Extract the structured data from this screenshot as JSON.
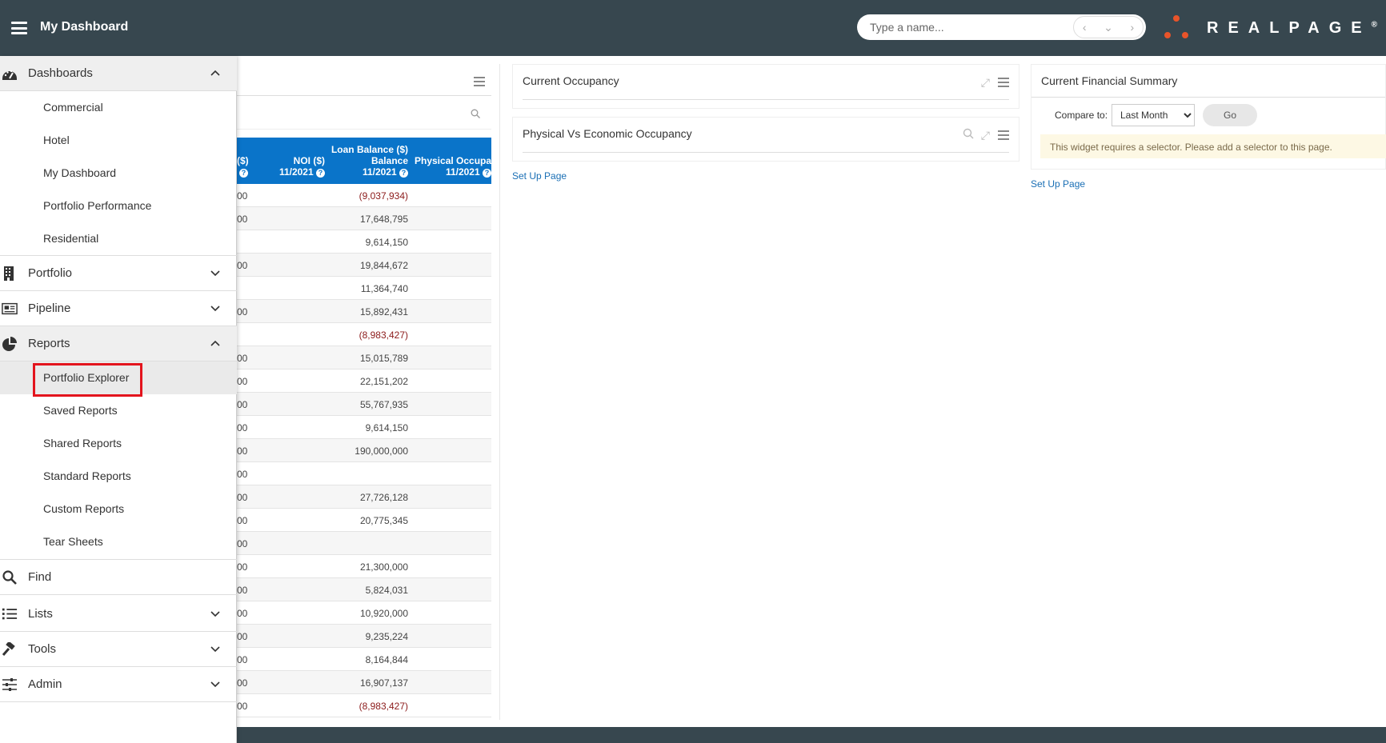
{
  "header": {
    "title": "My Dashboard",
    "search_placeholder": "Type a name...",
    "nav_prev": "‹",
    "nav_down": "⌄",
    "nav_next": "›",
    "logo_text": "REALPAGE",
    "logo_trademark": "®"
  },
  "sidebar": {
    "sections": [
      {
        "label": "Dashboards",
        "icon": "dashboard-gauge-icon",
        "expanded": true,
        "items": [
          "Commercial",
          "Hotel",
          "My Dashboard",
          "Portfolio Performance",
          "Residential"
        ]
      },
      {
        "label": "Portfolio",
        "icon": "building-icon",
        "expanded": false
      },
      {
        "label": "Pipeline",
        "icon": "newspaper-icon",
        "expanded": false
      },
      {
        "label": "Reports",
        "icon": "pie-chart-icon",
        "expanded": true,
        "items": [
          "Portfolio Explorer",
          "Saved Reports",
          "Shared Reports",
          "Standard Reports",
          "Custom Reports",
          "Tear Sheets"
        ],
        "active_item": "Portfolio Explorer"
      },
      {
        "label": "Find",
        "icon": "search-icon"
      },
      {
        "label": "Lists",
        "icon": "list-icon",
        "expanded": false
      },
      {
        "label": "Tools",
        "icon": "hammer-icon",
        "expanded": false
      },
      {
        "label": "Admin",
        "icon": "sliders-icon",
        "expanded": false
      }
    ]
  },
  "table_widget": {
    "columns": [
      {
        "line1": "",
        "line2": "($)",
        "line3": "?"
      },
      {
        "line1": "",
        "line2": "NOI ($)",
        "line3": "11/2021"
      },
      {
        "line1": "Loan Balance ($)",
        "line2": "Balance",
        "line3": "11/2021"
      },
      {
        "line1": "",
        "line2": "Physical Occupan",
        "line3": "11/2021"
      }
    ],
    "rows": [
      {
        "c1": "00",
        "loan": "(9,037,934)",
        "neg": true
      },
      {
        "c1": "00",
        "loan": "17,648,795"
      },
      {
        "c1": "",
        "loan": "9,614,150"
      },
      {
        "c1": "00",
        "loan": "19,844,672"
      },
      {
        "c1": "",
        "loan": "11,364,740"
      },
      {
        "c1": "00",
        "loan": "15,892,431"
      },
      {
        "c1": "",
        "loan": "(8,983,427)",
        "neg": true
      },
      {
        "c1": "00",
        "loan": "15,015,789"
      },
      {
        "c1": "00",
        "loan": "22,151,202"
      },
      {
        "c1": "00",
        "loan": "55,767,935"
      },
      {
        "c1": "00",
        "loan": "9,614,150"
      },
      {
        "c1": "00",
        "loan": "190,000,000"
      },
      {
        "c1": "00",
        "loan": ""
      },
      {
        "c1": "00",
        "loan": "27,726,128"
      },
      {
        "c1": "00",
        "loan": "20,775,345"
      },
      {
        "c1": "00",
        "loan": ""
      },
      {
        "c1": "00",
        "loan": "21,300,000"
      },
      {
        "c1": "00",
        "loan": "5,824,031"
      },
      {
        "c1": "00",
        "loan": "10,920,000"
      },
      {
        "c1": "00",
        "loan": "9,235,224"
      },
      {
        "c1": "00",
        "loan": "8,164,844"
      },
      {
        "c1": "00",
        "loan": "16,907,137"
      },
      {
        "c1": "00",
        "loan": "(8,983,427)",
        "neg": true
      }
    ]
  },
  "widgets": {
    "current_occupancy": {
      "title": "Current Occupancy"
    },
    "phys_vs_econ": {
      "title": "Physical Vs Economic Occupancy"
    },
    "setup_link_1": "Set Up Page",
    "financial_summary": {
      "title": "Current Financial Summary",
      "compare_label": "Compare to:",
      "compare_value": "Last Month",
      "go_label": "Go",
      "notice": "This widget requires a selector. Please add a selector to this page."
    },
    "setup_link_2": "Set Up Page"
  },
  "colors": {
    "topbar": "#37474f",
    "table_header": "#0a74c9",
    "highlight": "#e3141d",
    "logo_dots": "#e8542a",
    "negative": "#8b1a1a"
  }
}
